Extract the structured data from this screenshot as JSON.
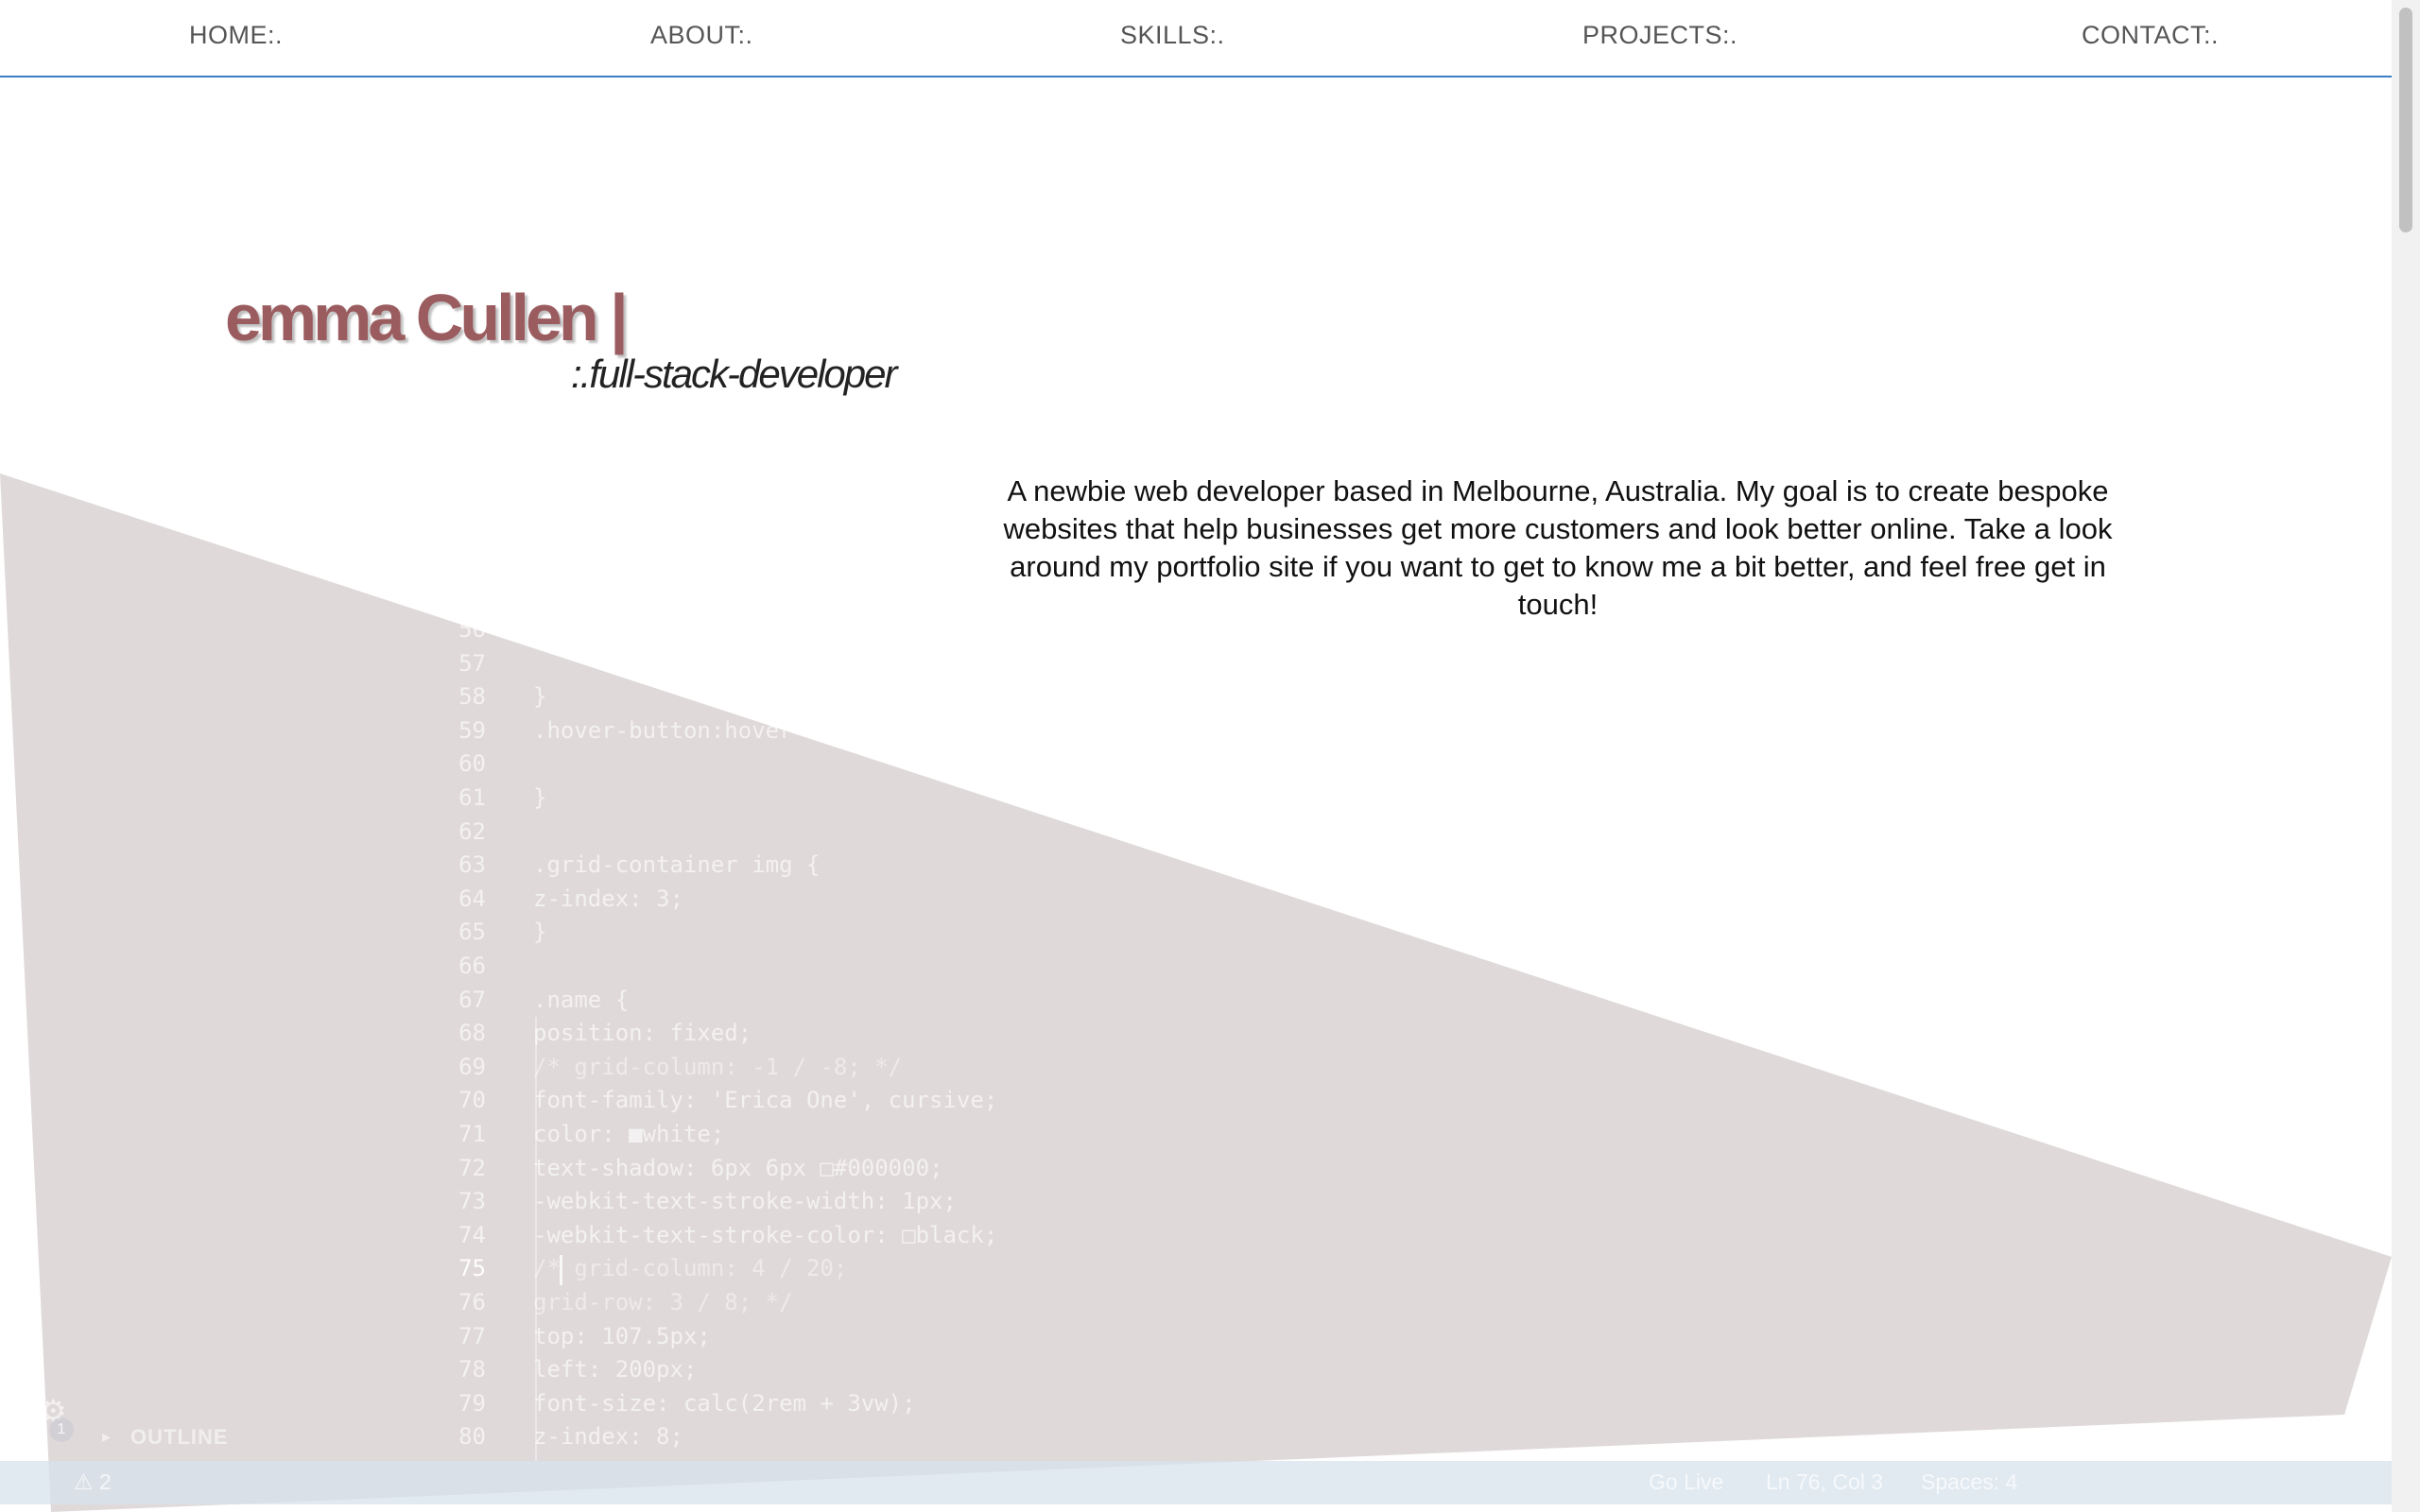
{
  "nav": {
    "items": [
      "HOME:.",
      "ABOUT:.",
      "SKILLS:.",
      "PROJECTS:.",
      "CONTACT:."
    ]
  },
  "hero": {
    "name": "emma Cullen |",
    "subtitle": ":.full-stack-developer",
    "intro": "A newbie web developer based in Melbourne, Australia. My goal is to create bespoke websites that help businesses get more customers and look better online. Take a look around my portfolio site if you want to get to know me a bit better, and feel free get in touch!"
  },
  "ghost_editor": {
    "code_lines": [
      {
        "n": "56",
        "t": ""
      },
      {
        "n": "57",
        "t": ""
      },
      {
        "n": "58",
        "t": "}"
      },
      {
        "n": "59",
        "t": ".hover-button:hover"
      },
      {
        "n": "60",
        "t": ""
      },
      {
        "n": "61",
        "t": "}"
      },
      {
        "n": "62",
        "t": ""
      },
      {
        "n": "63",
        "t": ".grid-container img {"
      },
      {
        "n": "64",
        "t": "    z-index: 3;"
      },
      {
        "n": "65",
        "t": "}"
      },
      {
        "n": "66",
        "t": ""
      },
      {
        "n": "67",
        "t": ".name {"
      },
      {
        "n": "68",
        "t": "    position: fixed;"
      },
      {
        "n": "69",
        "t": "    /* grid-column: -1 / -8; */"
      },
      {
        "n": "70",
        "t": "    font-family: 'Erica One', cursive;"
      },
      {
        "n": "71",
        "t": "    color: ■white;"
      },
      {
        "n": "72",
        "t": "    text-shadow: 6px 6px □#000000;"
      },
      {
        "n": "73",
        "t": "    -webkit-text-stroke-width: 1px;"
      },
      {
        "n": "74",
        "t": "    -webkit-text-stroke-color: □black;"
      },
      {
        "n": "75",
        "t": "    /* grid-column: 4 / 20;"
      },
      {
        "n": "76",
        "t": "    grid-row: 3 / 8; */"
      },
      {
        "n": "77",
        "t": "    top: 107.5px;"
      },
      {
        "n": "78",
        "t": "    left: 200px;"
      },
      {
        "n": "79",
        "t": "    font-size: calc(2rem + 3vw);"
      },
      {
        "n": "80",
        "t": "    z-index: 8;"
      }
    ],
    "outline_label": "OUTLINE",
    "badge_count": "1",
    "status": {
      "warnings": "⚠ 2",
      "go_live": "Go Live",
      "position": "Ln 76, Col 3",
      "spaces": "Spaces: 4"
    }
  },
  "colors": {
    "name": "#9b5c5f",
    "nav_border": "#3d7fc4",
    "shape": "#e0d9da"
  }
}
